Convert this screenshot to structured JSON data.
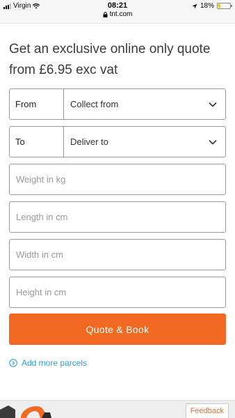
{
  "status_bar": {
    "carrier": "Virgin",
    "time": "08:21",
    "url": "tnt.com",
    "battery": "18%",
    "battery_level": 0.18
  },
  "heading": "Get an exclusive online only quote from £6.95 exc vat",
  "from_field": {
    "label": "From",
    "value": "Collect from"
  },
  "to_field": {
    "label": "To",
    "value": "Deliver to"
  },
  "inputs": {
    "weight_placeholder": "Weight in kg",
    "length_placeholder": "Length in cm",
    "width_placeholder": "Width in cm",
    "height_placeholder": "Height in cm"
  },
  "quote_button_label": "Quote & Book",
  "add_parcels_label": "Add more parcels",
  "feedback_label": "Feedback",
  "colors": {
    "accent_orange": "#f26a21",
    "link_blue": "#2a9fd8",
    "border_gray": "#999999"
  },
  "icons": [
    "signal-icon",
    "wifi-icon",
    "lock-icon",
    "location-icon",
    "battery-icon",
    "chevron-down-icon",
    "chevron-circle-icon"
  ]
}
